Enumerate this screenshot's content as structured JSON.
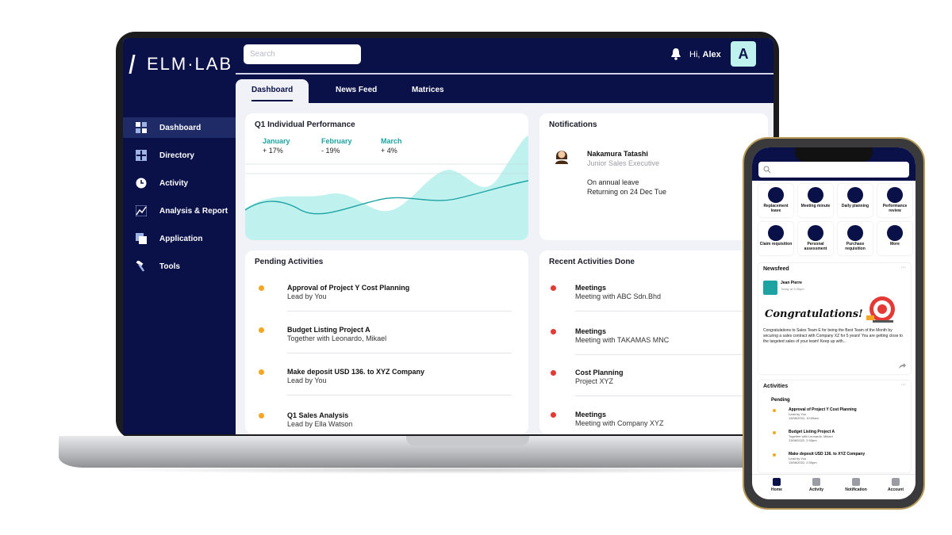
{
  "laptop": {
    "logo_text": "ELM·LAB",
    "search_placeholder": "Search",
    "greeting_prefix": "Hi,",
    "user_name": "Alex",
    "avatar_letter": "A",
    "sidebar": [
      {
        "label": "Dashboard",
        "icon": "grid-icon",
        "active": true
      },
      {
        "label": "Directory",
        "icon": "plus-square-icon"
      },
      {
        "label": "Activity",
        "icon": "clock-icon"
      },
      {
        "label": "Analysis & Report",
        "icon": "line-chart-icon"
      },
      {
        "label": "Application",
        "icon": "copy-icon"
      },
      {
        "label": "Tools",
        "icon": "hammer-icon"
      }
    ],
    "tabs": [
      {
        "label": "Dashboard",
        "active": true
      },
      {
        "label": "News Feed"
      },
      {
        "label": "Matrices"
      }
    ],
    "performance": {
      "title": "Q1 Individual Performance",
      "months": [
        {
          "name": "January",
          "change": "+ 17%"
        },
        {
          "name": "February",
          "change": "- 19%"
        },
        {
          "name": "March",
          "change": "+ 4%"
        }
      ]
    },
    "notifications": {
      "title": "Notifications",
      "name": "Nakamura Tatashi",
      "role": "Junior Sales Executive",
      "line1": "On annual leave",
      "line2": "Returning on 24 Dec Tue"
    },
    "pending": {
      "title": "Pending Activities",
      "items": [
        {
          "title": "Approval of Project Y Cost Planning",
          "sub": "Lead by You"
        },
        {
          "title": "Budget Listing Project A",
          "sub": "Together with Leonardo, Mikael"
        },
        {
          "title": "Make deposit USD 136. to XYZ Company",
          "sub": "Lead by You"
        },
        {
          "title": "Q1 Sales Analysis",
          "sub": "Lead by Ella Watson"
        }
      ],
      "dot_color": "#f5a623"
    },
    "recent": {
      "title": "Recent Activities Done",
      "items": [
        {
          "title": "Meetings",
          "sub": "Meeting with ABC Sdn.Bhd"
        },
        {
          "title": "Meetings",
          "sub": "Meeting with TAKAMAS MNC"
        },
        {
          "title": "Cost Planning",
          "sub": "Project XYZ"
        },
        {
          "title": "Meetings",
          "sub": "Meeting with Company XYZ"
        }
      ],
      "dot_color": "#e53935"
    },
    "colors": {
      "navy": "#0a1048",
      "teal": "#1ea3a3",
      "teal_fill": "#bff2ee"
    }
  },
  "phone": {
    "tiles": [
      {
        "label": "Replacement leave"
      },
      {
        "label": "Meeting minute"
      },
      {
        "label": "Daily planning"
      },
      {
        "label": "Performance review"
      },
      {
        "label": "Claim requisition"
      },
      {
        "label": "Personal assessment"
      },
      {
        "label": "Purchase requisition"
      },
      {
        "label": "More"
      }
    ],
    "newsfeed": {
      "title": "Newsfeed",
      "author": "Jean Pierre",
      "time": "Today at 9:30pm",
      "headline": "Congratulations!",
      "body": "Congratulations to Sales Team E for being the Best Team of the Month by securing a sales contract with Company XZ for 5 years! You are getting close to the targeted sales of your team! Keep up with..."
    },
    "activities": {
      "title": "Activities",
      "subtitle": "Pending",
      "items": [
        {
          "title": "Approval of Project Y Cost Planning",
          "sub": "Lead by You",
          "date": "13/08/2022, 10:00am"
        },
        {
          "title": "Budget Listing Project A",
          "sub": "Together with Leonardo, Mikael",
          "date": "13/08/2022, 2:00pm"
        },
        {
          "title": "Make deposit USD 136. to XYZ Company",
          "sub": "Lead by You",
          "date": "13/08/2022, 2:00pm"
        }
      ]
    },
    "tabbar": [
      {
        "label": "Home",
        "active": true
      },
      {
        "label": "Activity"
      },
      {
        "label": "Notification"
      },
      {
        "label": "Account"
      }
    ]
  }
}
